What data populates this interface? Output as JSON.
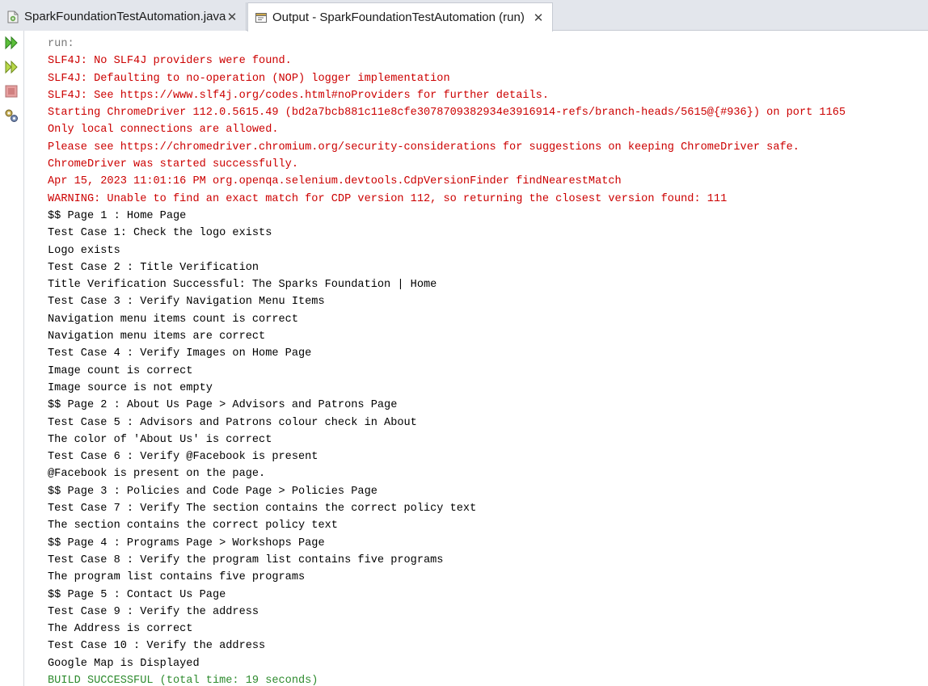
{
  "tabs": [
    {
      "label": "SparkFoundationTestAutomation.java",
      "close": "✕"
    },
    {
      "label": "Output - SparkFoundationTestAutomation (run)",
      "close": "✕"
    }
  ],
  "toolbar": {
    "icons": [
      "rerun-icon",
      "rerun-with-options-icon",
      "stop-icon",
      "settings-icon"
    ]
  },
  "colors": {
    "error": "#cc0000",
    "run": "#777777",
    "success": "#2e8b2e",
    "normal": "#000000"
  },
  "output": {
    "lines": [
      {
        "text": "run:",
        "type": "run"
      },
      {
        "text": "SLF4J: No SLF4J providers were found.",
        "type": "err"
      },
      {
        "text": "SLF4J: Defaulting to no-operation (NOP) logger implementation",
        "type": "err"
      },
      {
        "text": "SLF4J: See https://www.slf4j.org/codes.html#noProviders for further details.",
        "type": "err"
      },
      {
        "text": "Starting ChromeDriver 112.0.5615.49 (bd2a7bcb881c11e8cfe3078709382934e3916914-refs/branch-heads/5615@{#936}) on port 1165",
        "type": "err"
      },
      {
        "text": "Only local connections are allowed.",
        "type": "err"
      },
      {
        "text": "Please see https://chromedriver.chromium.org/security-considerations for suggestions on keeping ChromeDriver safe.",
        "type": "err"
      },
      {
        "text": "ChromeDriver was started successfully.",
        "type": "err"
      },
      {
        "text": "Apr 15, 2023 11:01:16 PM org.openqa.selenium.devtools.CdpVersionFinder findNearestMatch",
        "type": "err"
      },
      {
        "text": "WARNING: Unable to find an exact match for CDP version 112, so returning the closest version found: 111",
        "type": "err"
      },
      {
        "text": "$$ Page 1 : Home Page",
        "type": "normal"
      },
      {
        "text": "Test Case 1: Check the logo exists",
        "type": "normal"
      },
      {
        "text": "Logo exists",
        "type": "normal"
      },
      {
        "text": "Test Case 2 : Title Verification",
        "type": "normal"
      },
      {
        "text": "Title Verification Successful: The Sparks Foundation | Home",
        "type": "normal"
      },
      {
        "text": "Test Case 3 : Verify Navigation Menu Items",
        "type": "normal"
      },
      {
        "text": "Navigation menu items count is correct",
        "type": "normal"
      },
      {
        "text": "Navigation menu items are correct",
        "type": "normal"
      },
      {
        "text": "Test Case 4 : Verify Images on Home Page",
        "type": "normal"
      },
      {
        "text": "Image count is correct",
        "type": "normal"
      },
      {
        "text": "Image source is not empty",
        "type": "normal"
      },
      {
        "text": "$$ Page 2 : About Us Page > Advisors and Patrons Page",
        "type": "normal"
      },
      {
        "text": "Test Case 5 : Advisors and Patrons colour check in About",
        "type": "normal"
      },
      {
        "text": "The color of 'About Us' is correct",
        "type": "normal"
      },
      {
        "text": "Test Case 6 : Verify @Facebook is present",
        "type": "normal"
      },
      {
        "text": "@Facebook is present on the page.",
        "type": "normal"
      },
      {
        "text": "$$ Page 3 : Policies and Code Page > Policies Page",
        "type": "normal"
      },
      {
        "text": "Test Case 7 : Verify The section contains the correct policy text",
        "type": "normal"
      },
      {
        "text": "The section contains the correct policy text",
        "type": "normal"
      },
      {
        "text": "$$ Page 4 : Programs Page > Workshops Page",
        "type": "normal"
      },
      {
        "text": "Test Case 8 : Verify the program list contains five programs",
        "type": "normal"
      },
      {
        "text": "The program list contains five programs",
        "type": "normal"
      },
      {
        "text": "$$ Page 5 : Contact Us Page",
        "type": "normal"
      },
      {
        "text": "Test Case 9 : Verify the address",
        "type": "normal"
      },
      {
        "text": "The Address is correct",
        "type": "normal"
      },
      {
        "text": "Test Case 10 : Verify the address",
        "type": "normal"
      },
      {
        "text": "Google Map is Displayed",
        "type": "normal"
      },
      {
        "text": "BUILD SUCCESSFUL (total time: 19 seconds)",
        "type": "ok"
      }
    ]
  }
}
